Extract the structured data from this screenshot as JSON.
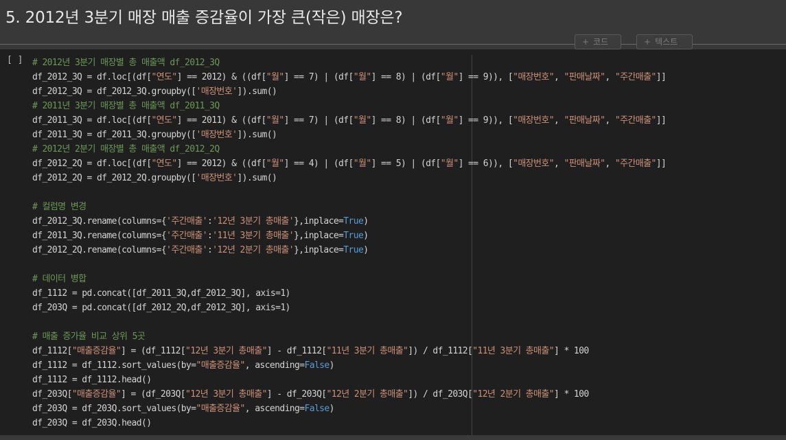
{
  "header": {
    "title": "5. 2012년 3분기 매장 매출 증감율이 가장 큰(작은) 매장은?"
  },
  "toolbar": {
    "add_code_plus": "+",
    "add_code_label": "코드",
    "add_text_plus": "+",
    "add_text_label": "텍스트"
  },
  "cell": {
    "run_label": "[ ]",
    "lines": [
      [
        {
          "t": "# 2012년 3분기 매장별 총 매출액 df_2012_3Q",
          "c": "cmt"
        }
      ],
      [
        {
          "t": "df_2012_3Q = df.loc[(df[",
          "c": ""
        },
        {
          "t": "\"연도\"",
          "c": "str"
        },
        {
          "t": "] == 2012) & ((df[",
          "c": ""
        },
        {
          "t": "\"월\"",
          "c": "str"
        },
        {
          "t": "] == 7) | (df[",
          "c": ""
        },
        {
          "t": "\"월\"",
          "c": "str"
        },
        {
          "t": "] == 8) | (df[",
          "c": ""
        },
        {
          "t": "\"월\"",
          "c": "str"
        },
        {
          "t": "] == 9)), [",
          "c": ""
        },
        {
          "t": "\"매장번호\"",
          "c": "str"
        },
        {
          "t": ", ",
          "c": ""
        },
        {
          "t": "\"판매날짜\"",
          "c": "str"
        },
        {
          "t": ", ",
          "c": ""
        },
        {
          "t": "\"주간매출\"",
          "c": "str"
        },
        {
          "t": "]]",
          "c": ""
        }
      ],
      [
        {
          "t": "df_2012_3Q = df_2012_3Q.groupby([",
          "c": ""
        },
        {
          "t": "'매장번호'",
          "c": "str"
        },
        {
          "t": "]).sum()",
          "c": ""
        }
      ],
      [
        {
          "t": "# 2011년 3분기 매장별 총 매출액 df_2011_3Q",
          "c": "cmt"
        }
      ],
      [
        {
          "t": "df_2011_3Q = df.loc[(df[",
          "c": ""
        },
        {
          "t": "\"연도\"",
          "c": "str"
        },
        {
          "t": "] == 2011) & ((df[",
          "c": ""
        },
        {
          "t": "\"월\"",
          "c": "str"
        },
        {
          "t": "] == 7) | (df[",
          "c": ""
        },
        {
          "t": "\"월\"",
          "c": "str"
        },
        {
          "t": "] == 8) | (df[",
          "c": ""
        },
        {
          "t": "\"월\"",
          "c": "str"
        },
        {
          "t": "] == 9)), [",
          "c": ""
        },
        {
          "t": "\"매장번호\"",
          "c": "str"
        },
        {
          "t": ", ",
          "c": ""
        },
        {
          "t": "\"판매날짜\"",
          "c": "str"
        },
        {
          "t": ", ",
          "c": ""
        },
        {
          "t": "\"주간매출\"",
          "c": "str"
        },
        {
          "t": "]]",
          "c": ""
        }
      ],
      [
        {
          "t": "df_2011_3Q = df_2011_3Q.groupby([",
          "c": ""
        },
        {
          "t": "'매장번호'",
          "c": "str"
        },
        {
          "t": "]).sum()",
          "c": ""
        }
      ],
      [
        {
          "t": "# 2012년 2분기 매장별 총 매출액 df_2012_2Q",
          "c": "cmt"
        }
      ],
      [
        {
          "t": "df_2012_2Q = df.loc[(df[",
          "c": ""
        },
        {
          "t": "\"연도\"",
          "c": "str"
        },
        {
          "t": "] == 2012) & ((df[",
          "c": ""
        },
        {
          "t": "\"월\"",
          "c": "str"
        },
        {
          "t": "] == 4) | (df[",
          "c": ""
        },
        {
          "t": "\"월\"",
          "c": "str"
        },
        {
          "t": "] == 5) | (df[",
          "c": ""
        },
        {
          "t": "\"월\"",
          "c": "str"
        },
        {
          "t": "] == 6)), [",
          "c": ""
        },
        {
          "t": "\"매장번호\"",
          "c": "str"
        },
        {
          "t": ", ",
          "c": ""
        },
        {
          "t": "\"판매날짜\"",
          "c": "str"
        },
        {
          "t": ", ",
          "c": ""
        },
        {
          "t": "\"주간매출\"",
          "c": "str"
        },
        {
          "t": "]]",
          "c": ""
        }
      ],
      [
        {
          "t": "df_2012_2Q = df_2012_2Q.groupby([",
          "c": ""
        },
        {
          "t": "'매장번호'",
          "c": "str"
        },
        {
          "t": "]).sum()",
          "c": ""
        }
      ],
      [],
      [
        {
          "t": "# 컬럼명 변경",
          "c": "cmt"
        }
      ],
      [
        {
          "t": "df_2012_3Q.rename(columns={",
          "c": ""
        },
        {
          "t": "'주간매출'",
          "c": "str"
        },
        {
          "t": ":",
          "c": ""
        },
        {
          "t": "'12년 3분기 총매출'",
          "c": "str"
        },
        {
          "t": "},inplace=",
          "c": ""
        },
        {
          "t": "True",
          "c": "kw"
        },
        {
          "t": ")",
          "c": ""
        }
      ],
      [
        {
          "t": "df_2011_3Q.rename(columns={",
          "c": ""
        },
        {
          "t": "'주간매출'",
          "c": "str"
        },
        {
          "t": ":",
          "c": ""
        },
        {
          "t": "'11년 3분기 총매출'",
          "c": "str"
        },
        {
          "t": "},inplace=",
          "c": ""
        },
        {
          "t": "True",
          "c": "kw"
        },
        {
          "t": ")",
          "c": ""
        }
      ],
      [
        {
          "t": "df_2012_2Q.rename(columns={",
          "c": ""
        },
        {
          "t": "'주간매출'",
          "c": "str"
        },
        {
          "t": ":",
          "c": ""
        },
        {
          "t": "'12년 2분기 총매출'",
          "c": "str"
        },
        {
          "t": "},inplace=",
          "c": ""
        },
        {
          "t": "True",
          "c": "kw"
        },
        {
          "t": ")",
          "c": ""
        }
      ],
      [],
      [
        {
          "t": "# 데이터 병합",
          "c": "cmt"
        }
      ],
      [
        {
          "t": "df_1112 = pd.concat([df_2011_3Q,df_2012_3Q], axis=1)",
          "c": ""
        }
      ],
      [
        {
          "t": "df_203Q = pd.concat([df_2012_2Q,df_2012_3Q], axis=1)",
          "c": ""
        }
      ],
      [],
      [
        {
          "t": "# 매출 증가율 비교 상위 5곳",
          "c": "cmt"
        }
      ],
      [
        {
          "t": "df_1112[",
          "c": ""
        },
        {
          "t": "\"매출증감율\"",
          "c": "str"
        },
        {
          "t": "] = (df_1112[",
          "c": ""
        },
        {
          "t": "\"12년 3분기 총매출\"",
          "c": "str"
        },
        {
          "t": "] - df_1112[",
          "c": ""
        },
        {
          "t": "\"11년 3분기 총매출\"",
          "c": "str"
        },
        {
          "t": "]) / df_1112[",
          "c": ""
        },
        {
          "t": "\"11년 3분기 총매출\"",
          "c": "str"
        },
        {
          "t": "] * 100",
          "c": ""
        }
      ],
      [
        {
          "t": "df_1112 = df_1112.sort_values(by=",
          "c": ""
        },
        {
          "t": "\"매출증감율\"",
          "c": "str"
        },
        {
          "t": ", ascending=",
          "c": ""
        },
        {
          "t": "False",
          "c": "kw"
        },
        {
          "t": ")",
          "c": ""
        }
      ],
      [
        {
          "t": "df_1112 = df_1112.head()",
          "c": ""
        }
      ],
      [
        {
          "t": "df_203Q[",
          "c": ""
        },
        {
          "t": "\"매출증감율\"",
          "c": "str"
        },
        {
          "t": "] = (df_203Q[",
          "c": ""
        },
        {
          "t": "\"12년 3분기 총매출\"",
          "c": "str"
        },
        {
          "t": "] - df_203Q[",
          "c": ""
        },
        {
          "t": "\"12년 2분기 총매출\"",
          "c": "str"
        },
        {
          "t": "]) / df_203Q[",
          "c": ""
        },
        {
          "t": "\"12년 2분기 총매출\"",
          "c": "str"
        },
        {
          "t": "] * 100",
          "c": ""
        }
      ],
      [
        {
          "t": "df_203Q = df_203Q.sort_values(by=",
          "c": ""
        },
        {
          "t": "\"매출증감율\"",
          "c": "str"
        },
        {
          "t": ", ascending=",
          "c": ""
        },
        {
          "t": "False",
          "c": "kw"
        },
        {
          "t": ")",
          "c": ""
        }
      ],
      [
        {
          "t": "df_203Q = df_203Q.head()",
          "c": ""
        }
      ]
    ]
  }
}
